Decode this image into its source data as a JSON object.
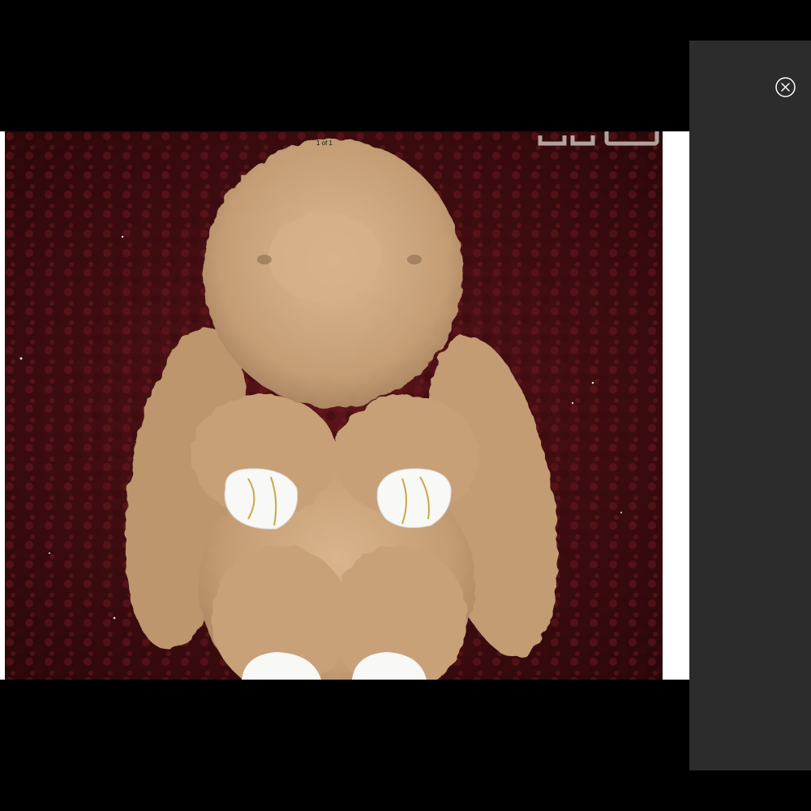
{
  "viewer": {
    "counter_text": "1 of 1",
    "close_icon": "close-circle-icon"
  },
  "colors": {
    "backdrop": "#000000",
    "side_panel": "#2c2c2c",
    "frame": "#ffffff",
    "carpet": "#4a0f12",
    "fur": "#c9a47e",
    "paws": "#f7f7f5"
  }
}
